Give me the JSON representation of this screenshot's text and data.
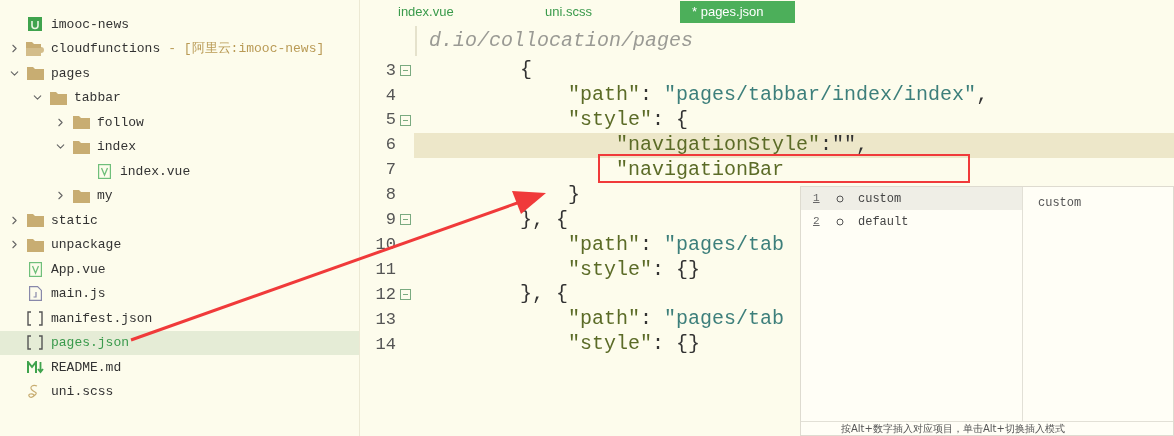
{
  "sidebar": {
    "items": [
      {
        "name": "imooc-news",
        "kind": "project",
        "selected": false
      },
      {
        "name": "cloudfunctions",
        "suffix": "- [阿里云:imooc-news]",
        "kind": "cloud-folder",
        "expanded": false
      },
      {
        "name": "pages",
        "kind": "folder",
        "expanded": true,
        "children": [
          {
            "name": "tabbar",
            "kind": "folder",
            "expanded": true,
            "children": [
              {
                "name": "follow",
                "kind": "folder",
                "expanded": false
              },
              {
                "name": "index",
                "kind": "folder",
                "expanded": true,
                "children": [
                  {
                    "name": "index.vue",
                    "kind": "vue",
                    "selected": false
                  }
                ]
              },
              {
                "name": "my",
                "kind": "folder",
                "expanded": false
              }
            ]
          }
        ]
      },
      {
        "name": "static",
        "kind": "folder",
        "expanded": false
      },
      {
        "name": "unpackage",
        "kind": "folder",
        "expanded": false
      },
      {
        "name": "App.vue",
        "kind": "vue",
        "selected": false
      },
      {
        "name": "main.js",
        "kind": "js",
        "selected": false
      },
      {
        "name": "manifest.json",
        "kind": "json",
        "selected": false
      },
      {
        "name": "pages.json",
        "kind": "json",
        "selected": true
      },
      {
        "name": "README.md",
        "kind": "md",
        "selected": false
      },
      {
        "name": "uni.scss",
        "kind": "scss",
        "selected": false
      }
    ]
  },
  "tabs": [
    {
      "label": "index.vue",
      "selected": false
    },
    {
      "label": "uni.scss",
      "selected": false
    },
    {
      "label": "* pages.json",
      "selected": true
    }
  ],
  "editor": {
    "breadcrumb": "d.io/collocation/pages",
    "lines": [
      {
        "number": "3",
        "fold": true,
        "current": false,
        "tokens": [
          {
            "kind": "punct",
            "text": "        {"
          }
        ]
      },
      {
        "number": "4",
        "fold": false,
        "current": false,
        "tokens": [
          {
            "kind": "key",
            "text": "            \"path\""
          },
          {
            "kind": "punct",
            "text": ": "
          },
          {
            "kind": "string",
            "text": "\"pages/tabbar/index/index\""
          },
          {
            "kind": "punct",
            "text": ","
          }
        ]
      },
      {
        "number": "5",
        "fold": true,
        "current": false,
        "tokens": [
          {
            "kind": "key",
            "text": "            \"style\""
          },
          {
            "kind": "punct",
            "text": ": {"
          }
        ]
      },
      {
        "number": "6",
        "fold": false,
        "current": true,
        "tokens": [
          {
            "kind": "key",
            "text": "                \"navigationStyle\""
          },
          {
            "kind": "punct",
            "text": ":\"\","
          }
        ]
      },
      {
        "number": "7",
        "fold": false,
        "current": false,
        "tokens": [
          {
            "kind": "key",
            "text": "                \"navigationBar"
          }
        ]
      },
      {
        "number": "8",
        "fold": false,
        "current": false,
        "tokens": [
          {
            "kind": "punct",
            "text": "            }"
          }
        ]
      },
      {
        "number": "9",
        "fold": true,
        "current": false,
        "tokens": [
          {
            "kind": "punct",
            "text": "        }, {"
          }
        ]
      },
      {
        "number": "10",
        "fold": false,
        "current": false,
        "tokens": [
          {
            "kind": "key",
            "text": "            \"path\""
          },
          {
            "kind": "punct",
            "text": ": "
          },
          {
            "kind": "string",
            "text": "\"pages/tab"
          }
        ]
      },
      {
        "number": "11",
        "fold": false,
        "current": false,
        "tokens": [
          {
            "kind": "key",
            "text": "            \"style\""
          },
          {
            "kind": "punct",
            "text": ": {}"
          }
        ]
      },
      {
        "number": "12",
        "fold": true,
        "current": false,
        "tokens": [
          {
            "kind": "punct",
            "text": "        }, {"
          }
        ]
      },
      {
        "number": "13",
        "fold": false,
        "current": false,
        "tokens": [
          {
            "kind": "key",
            "text": "            \"path\""
          },
          {
            "kind": "punct",
            "text": ": "
          },
          {
            "kind": "string",
            "text": "\"pages/tab"
          }
        ]
      },
      {
        "number": "14",
        "fold": false,
        "current": false,
        "tokens": [
          {
            "kind": "key",
            "text": "            \"style\""
          },
          {
            "kind": "punct",
            "text": ": {}"
          }
        ]
      }
    ]
  },
  "completion": {
    "items": [
      {
        "number": "1",
        "label": "custom",
        "selected": true
      },
      {
        "number": "2",
        "label": "default",
        "selected": false
      }
    ],
    "detail": "custom",
    "footer": "按Alt+数字插入对应项目，单击Alt+切换插入模式"
  }
}
